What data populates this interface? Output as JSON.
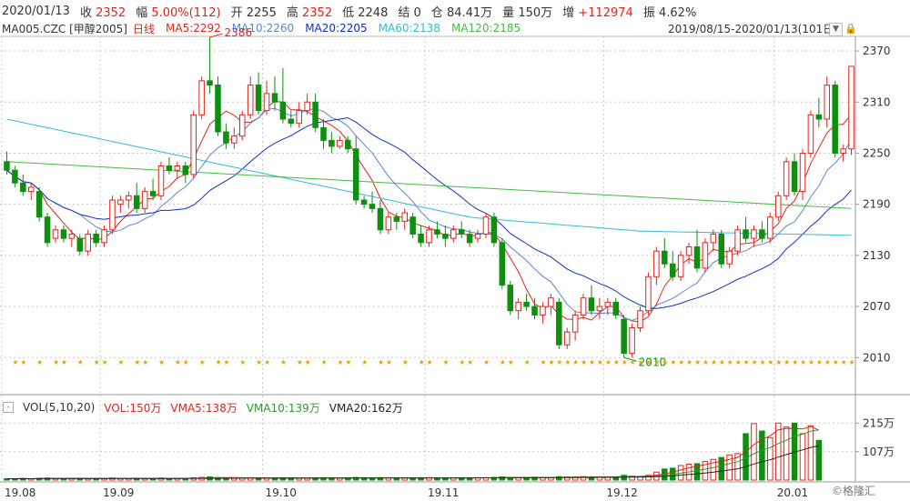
{
  "quote": {
    "date": "2020/01/13",
    "close_label": "收",
    "close": "2352",
    "change_label": "幅",
    "change": "5.00%(112)",
    "open_label": "开",
    "open": "2255",
    "high_label": "高",
    "high": "2352",
    "low_label": "低",
    "low": "2248",
    "settle_label": "结",
    "settle": "0",
    "oi_label": "仓",
    "oi": "84.41万",
    "volume_label": "量",
    "volume": "150万",
    "oi_change_label": "增",
    "oi_change": "+112974",
    "amplitude_label": "振",
    "amplitude": "4.62%"
  },
  "ma_bar": {
    "symbol": "MA005.CZC [甲醇2005]",
    "period": "日线",
    "ma5": "MA5:2292",
    "ma10": "MA10:2260",
    "ma20": "MA20:2205",
    "ma60": "MA60:2138",
    "ma120": "MA120:2185"
  },
  "range": "2019/08/15-2020/01/13(101日)",
  "dropdown_icon": "triangle-down-icon",
  "lock_icon": "lock-icon",
  "vol_bar": {
    "toggle": "-",
    "title": "VOL(5,10,20)",
    "vol": "VOL:150万",
    "vma5": "VMA5:138万",
    "vma10": "VMA10:139万",
    "vma20": "VMA20:162万"
  },
  "watermark": "©格隆汇",
  "colors": {
    "up": "#e0241b",
    "down": "#0f8f0f",
    "ma5": "#e0241b",
    "ma10": "#5a86c8",
    "ma20": "#1030c0",
    "ma60": "#33bbd8",
    "ma120": "#44bb44",
    "grid": "#c8c8c8"
  },
  "chart_data": [
    {
      "type": "candlestick",
      "title": "MA005.CZC [甲醇2005] 日线",
      "y_ticks": [
        2370,
        2310,
        2250,
        2190,
        2130,
        2070,
        2010
      ],
      "ylim": [
        1990,
        2385
      ],
      "x_ticks": [
        "19.08",
        "19.09",
        "19.10",
        "19.11",
        "19.12",
        "20.01"
      ],
      "annotations": {
        "max": "2386",
        "min": "2010"
      },
      "ohlc": [
        [
          2240,
          2252,
          2225,
          2230
        ],
        [
          2230,
          2235,
          2210,
          2215
        ],
        [
          2215,
          2225,
          2200,
          2205
        ],
        [
          2205,
          2215,
          2195,
          2210
        ],
        [
          2205,
          2210,
          2170,
          2175
        ],
        [
          2175,
          2180,
          2140,
          2145
        ],
        [
          2150,
          2165,
          2145,
          2160
        ],
        [
          2160,
          2165,
          2145,
          2150
        ],
        [
          2150,
          2160,
          2140,
          2155
        ],
        [
          2150,
          2155,
          2130,
          2135
        ],
        [
          2135,
          2160,
          2130,
          2155
        ],
        [
          2155,
          2160,
          2140,
          2145
        ],
        [
          2145,
          2165,
          2140,
          2160
        ],
        [
          2160,
          2200,
          2155,
          2195
        ],
        [
          2190,
          2200,
          2180,
          2195
        ],
        [
          2195,
          2205,
          2185,
          2200
        ],
        [
          2200,
          2215,
          2180,
          2185
        ],
        [
          2185,
          2210,
          2180,
          2205
        ],
        [
          2205,
          2220,
          2195,
          2200
        ],
        [
          2200,
          2240,
          2195,
          2235
        ],
        [
          2235,
          2245,
          2225,
          2230
        ],
        [
          2230,
          2240,
          2220,
          2235
        ],
        [
          2235,
          2240,
          2215,
          2225
        ],
        [
          2225,
          2300,
          2220,
          2295
        ],
        [
          2295,
          2340,
          2290,
          2335
        ],
        [
          2335,
          2386,
          2320,
          2330
        ],
        [
          2330,
          2340,
          2270,
          2275
        ],
        [
          2275,
          2285,
          2255,
          2262
        ],
        [
          2262,
          2280,
          2255,
          2270
        ],
        [
          2270,
          2300,
          2265,
          2295
        ],
        [
          2295,
          2340,
          2290,
          2330
        ],
        [
          2330,
          2345,
          2295,
          2300
        ],
        [
          2300,
          2335,
          2295,
          2320
        ],
        [
          2320,
          2340,
          2300,
          2310
        ],
        [
          2310,
          2350,
          2285,
          2290
        ],
        [
          2290,
          2300,
          2280,
          2285
        ],
        [
          2285,
          2310,
          2280,
          2300
        ],
        [
          2300,
          2320,
          2295,
          2310
        ],
        [
          2310,
          2320,
          2275,
          2280
        ],
        [
          2280,
          2290,
          2255,
          2265
        ],
        [
          2265,
          2275,
          2250,
          2258
        ],
        [
          2258,
          2270,
          2255,
          2265
        ],
        [
          2265,
          2270,
          2250,
          2255
        ],
        [
          2255,
          2270,
          2190,
          2195
        ],
        [
          2195,
          2200,
          2185,
          2190
        ],
        [
          2190,
          2205,
          2180,
          2185
        ],
        [
          2185,
          2195,
          2155,
          2160
        ],
        [
          2160,
          2180,
          2155,
          2175
        ],
        [
          2175,
          2180,
          2160,
          2170
        ],
        [
          2170,
          2185,
          2160,
          2180
        ],
        [
          2175,
          2180,
          2150,
          2155
        ],
        [
          2155,
          2165,
          2140,
          2145
        ],
        [
          2145,
          2165,
          2140,
          2160
        ],
        [
          2160,
          2170,
          2150,
          2155
        ],
        [
          2155,
          2165,
          2140,
          2150
        ],
        [
          2150,
          2165,
          2145,
          2160
        ],
        [
          2160,
          2170,
          2150,
          2155
        ],
        [
          2155,
          2160,
          2140,
          2145
        ],
        [
          2150,
          2160,
          2145,
          2155
        ],
        [
          2155,
          2180,
          2150,
          2175
        ],
        [
          2175,
          2180,
          2140,
          2145
        ],
        [
          2145,
          2150,
          2090,
          2095
        ],
        [
          2095,
          2100,
          2060,
          2065
        ],
        [
          2065,
          2080,
          2055,
          2075
        ],
        [
          2075,
          2085,
          2065,
          2070
        ],
        [
          2070,
          2080,
          2055,
          2060
        ],
        [
          2060,
          2075,
          2050,
          2070
        ],
        [
          2070,
          2085,
          2060,
          2080
        ],
        [
          2075,
          2080,
          2020,
          2025
        ],
        [
          2025,
          2045,
          2020,
          2040
        ],
        [
          2040,
          2065,
          2030,
          2060
        ],
        [
          2060,
          2085,
          2055,
          2080
        ],
        [
          2080,
          2095,
          2060,
          2065
        ],
        [
          2065,
          2080,
          2055,
          2070
        ],
        [
          2070,
          2080,
          2060,
          2075
        ],
        [
          2075,
          2080,
          2055,
          2060
        ],
        [
          2055,
          2060,
          2010,
          2015
        ],
        [
          2015,
          2050,
          2010,
          2045
        ],
        [
          2045,
          2070,
          2040,
          2065
        ],
        [
          2065,
          2110,
          2060,
          2105
        ],
        [
          2105,
          2140,
          2095,
          2135
        ],
        [
          2135,
          2150,
          2115,
          2120
        ],
        [
          2120,
          2135,
          2100,
          2105
        ],
        [
          2105,
          2135,
          2100,
          2130
        ],
        [
          2130,
          2145,
          2120,
          2140
        ],
        [
          2140,
          2160,
          2110,
          2115
        ],
        [
          2115,
          2150,
          2110,
          2145
        ],
        [
          2145,
          2160,
          2135,
          2155
        ],
        [
          2155,
          2160,
          2115,
          2120
        ],
        [
          2120,
          2140,
          2115,
          2135
        ],
        [
          2135,
          2165,
          2130,
          2160
        ],
        [
          2160,
          2175,
          2145,
          2150
        ],
        [
          2150,
          2165,
          2140,
          2160
        ],
        [
          2160,
          2170,
          2145,
          2150
        ],
        [
          2150,
          2180,
          2145,
          2175
        ],
        [
          2175,
          2205,
          2170,
          2200
        ],
        [
          2200,
          2245,
          2195,
          2240
        ],
        [
          2240,
          2250,
          2200,
          2205
        ],
        [
          2205,
          2255,
          2195,
          2250
        ],
        [
          2250,
          2300,
          2245,
          2295
        ],
        [
          2295,
          2315,
          2280,
          2290
        ],
        [
          2290,
          2340,
          2280,
          2330
        ],
        [
          2330,
          2335,
          2245,
          2250
        ],
        [
          2250,
          2260,
          2240,
          2255
        ],
        [
          2255,
          2352,
          2248,
          2352
        ]
      ]
    },
    {
      "type": "bar",
      "title": "VOL(5,10,20)",
      "y_ticks": [
        "215万",
        "107万"
      ],
      "ylim": [
        0,
        240
      ],
      "unit": "万",
      "volumes": [
        5,
        5,
        6,
        5,
        7,
        8,
        5,
        5,
        6,
        7,
        5,
        6,
        5,
        8,
        6,
        6,
        7,
        5,
        6,
        8,
        6,
        6,
        7,
        9,
        10,
        12,
        9,
        8,
        7,
        8,
        9,
        8,
        7,
        8,
        9,
        8,
        7,
        7,
        8,
        9,
        8,
        7,
        8,
        10,
        9,
        8,
        9,
        8,
        8,
        8,
        8,
        9,
        9,
        8,
        8,
        8,
        8,
        9,
        9,
        9,
        10,
        12,
        10,
        9,
        9,
        11,
        10,
        9,
        13,
        12,
        12,
        13,
        12,
        12,
        12,
        12,
        18,
        15,
        14,
        18,
        30,
        42,
        45,
        55,
        60,
        62,
        70,
        78,
        85,
        95,
        100,
        175,
        213,
        185,
        160,
        215,
        200,
        215,
        175,
        205,
        150
      ]
    }
  ]
}
